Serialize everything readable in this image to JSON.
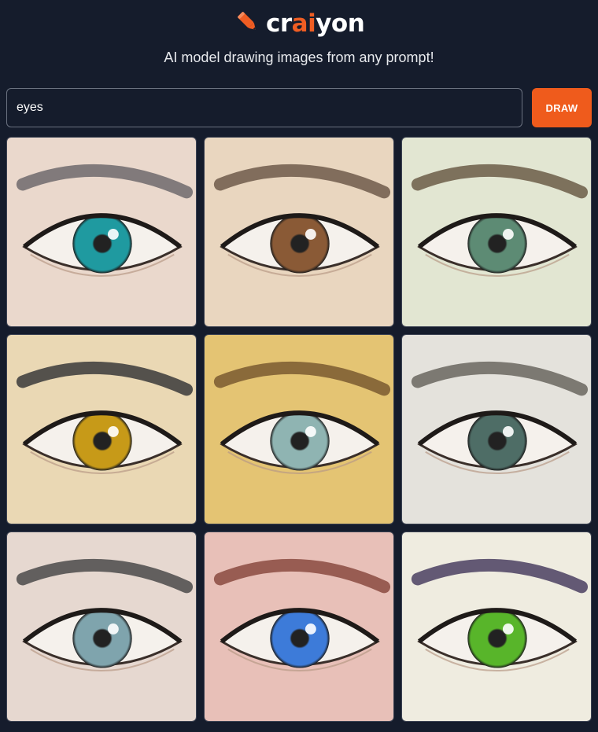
{
  "header": {
    "logo_prefix": "cr",
    "logo_accent": "ai",
    "logo_suffix": "yon",
    "tagline": "AI model drawing images from any prompt!"
  },
  "prompt": {
    "value": "eyes",
    "button_label": "DRAW"
  },
  "colors": {
    "background": "#151c2c",
    "accent": "#ef5b1c",
    "input_border": "#6b7280"
  },
  "gallery": {
    "images": [
      {
        "subject": "eye-image",
        "skin": "#ead8cc",
        "iris": "#1f9aa0",
        "brow": "#6f6a6c"
      },
      {
        "subject": "eye-image",
        "skin": "#e9d6bf",
        "iris": "#8a5a36",
        "brow": "#6e5a4a"
      },
      {
        "subject": "eye-image",
        "skin": "#e2e6d2",
        "iris": "#5d8b74",
        "brow": "#6b5c48"
      },
      {
        "subject": "eye-image",
        "skin": "#ead8b4",
        "iris": "#c79a18",
        "brow": "#3a3a3a"
      },
      {
        "subject": "eye-image",
        "skin": "#e4c473",
        "iris": "#8fb4b2",
        "brow": "#7a5a30"
      },
      {
        "subject": "eye-image",
        "skin": "#e4e2dc",
        "iris": "#4e6d66",
        "brow": "#6a665f"
      },
      {
        "subject": "eye-image",
        "skin": "#e6d8d0",
        "iris": "#7fa4ad",
        "brow": "#4a4a4a"
      },
      {
        "subject": "eye-image",
        "skin": "#e8c0b8",
        "iris": "#3d7bd9",
        "brow": "#8a4a40"
      },
      {
        "subject": "eye-image",
        "skin": "#efece0",
        "iris": "#58b52a",
        "brow": "#4a4060"
      }
    ]
  }
}
